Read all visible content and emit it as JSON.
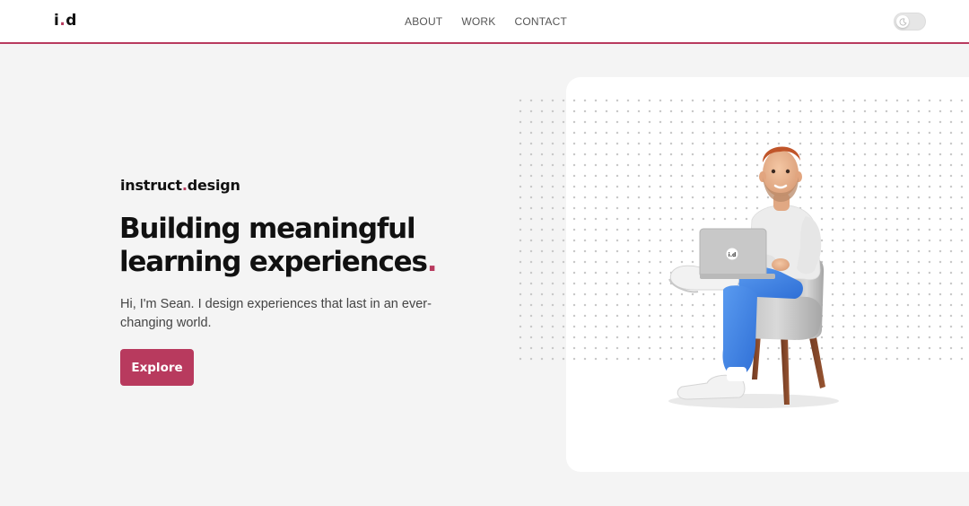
{
  "header": {
    "logo": {
      "prefix": "i",
      "dot": ".",
      "suffix": "d"
    },
    "nav": [
      {
        "label": "ABOUT"
      },
      {
        "label": "WORK"
      },
      {
        "label": "CONTACT"
      }
    ],
    "theme_toggle": {
      "icon": "moon-icon",
      "state": "off"
    }
  },
  "hero": {
    "brand": {
      "prefix": "instruct",
      "dot": ".",
      "suffix": "design"
    },
    "headline_line1": "Building meaningful",
    "headline_line2": "learning experiences",
    "headline_dot": ".",
    "intro": "Hi, I'm Sean. I design experiences that last in an ever-changing world.",
    "cta_label": "Explore",
    "illustration": {
      "subject": "person-with-laptop-on-chair",
      "laptop_logo": "i.d"
    }
  },
  "colors": {
    "accent": "#b83a5e",
    "background": "#f4f4f4",
    "card": "#ffffff",
    "text": "#111111"
  }
}
